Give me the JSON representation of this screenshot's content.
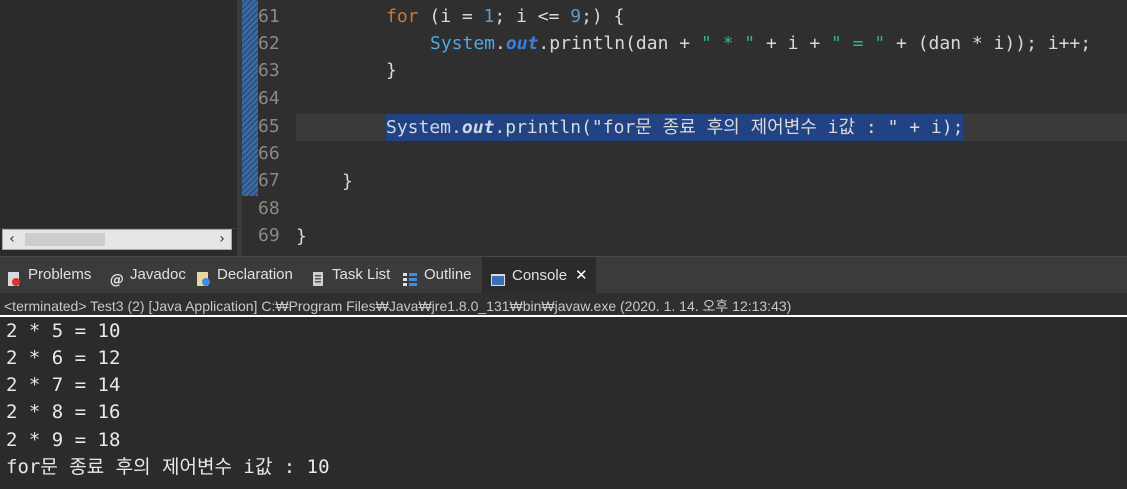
{
  "editor": {
    "line_numbers": [
      "61",
      "62",
      "63",
      "64",
      "65",
      "66",
      "67",
      "68",
      "69"
    ],
    "lines": {
      "l61": {
        "kw": "for",
        "a": " (i = ",
        "n1": "1",
        "b": "; i <= ",
        "n2": "9",
        "c": ";) {"
      },
      "l62": {
        "cls": "System",
        "dot": ".",
        "fld": "out",
        "a": ".println(dan + ",
        "s1": "\" * \"",
        "b": " + i + ",
        "s2": "\" = \"",
        "c": " + (dan * i)); i++;"
      },
      "l63": {
        "text": "}"
      },
      "l65": {
        "cls": "System",
        "dot": ".",
        "fld": "out",
        "a": ".println(\"for문 종료 후의 제어변수 i값 : \" + i);"
      },
      "l67": {
        "text": "}"
      },
      "l69": {
        "text": "}"
      }
    }
  },
  "tabs": [
    {
      "label": "Problems",
      "icon": "problems-icon"
    },
    {
      "label": "Javadoc",
      "icon": "javadoc-icon"
    },
    {
      "label": "Declaration",
      "icon": "declaration-icon"
    },
    {
      "label": "Task List",
      "icon": "task-list-icon"
    },
    {
      "label": "Outline",
      "icon": "outline-icon"
    },
    {
      "label": "Console",
      "icon": "console-icon",
      "active": true
    }
  ],
  "console": {
    "status": "<terminated> Test3 (2) [Java Application] C:₩Program Files₩Java₩jre1.8.0_131₩bin₩javaw.exe (2020. 1. 14. 오후 12:13:43)",
    "output": [
      "2 * 5 = 10",
      "2 * 6 = 12",
      "2 * 7 = 14",
      "2 * 8 = 16",
      "2 * 9 = 18",
      "for문 종료 후의 제어변수 i값 : 10"
    ]
  },
  "colors": {
    "keyword": "#cc7832",
    "class": "#4aa9e6",
    "string": "#37b08e",
    "number": "#6897bb",
    "selection": "#214283"
  }
}
